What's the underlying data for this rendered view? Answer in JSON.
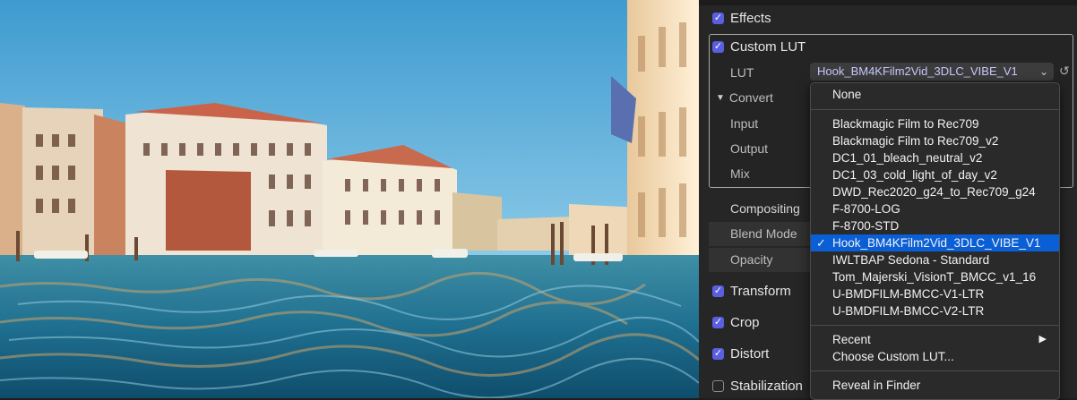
{
  "inspector": {
    "effects_label": "Effects",
    "custom_lut_label": "Custom LUT",
    "lut_label": "LUT",
    "lut_value": "Hook_BM4KFilm2Vid_3DLC_VIBE_V1",
    "convert_label": "Convert",
    "input_label": "Input",
    "output_label": "Output",
    "mix_label": "Mix",
    "compositing_label": "Compositing",
    "blend_mode_label": "Blend Mode",
    "opacity_label": "Opacity",
    "transform_label": "Transform",
    "crop_label": "Crop",
    "distort_label": "Distort",
    "stabilization_label": "Stabilization"
  },
  "lut_menu": {
    "none": "None",
    "items": [
      "Blackmagic Film to Rec709",
      "Blackmagic Film to Rec709_v2",
      "DC1_01_bleach_neutral_v2",
      "DC1_03_cold_light_of_day_v2",
      "DWD_Rec2020_g24_to_Rec709_g24",
      "F-8700-LOG",
      "F-8700-STD",
      "Hook_BM4KFilm2Vid_3DLC_VIBE_V1",
      "IWLTBAP Sedona - Standard",
      "Tom_Majerski_VisionT_BMCC_v1_16",
      "U-BMDFILM-BMCC-V1-LTR",
      "U-BMDFILM-BMCC-V2-LTR"
    ],
    "selected": "Hook_BM4KFilm2Vid_3DLC_VIBE_V1",
    "recent": "Recent",
    "choose_custom": "Choose Custom LUT...",
    "reveal": "Reveal in Finder"
  },
  "icons": {
    "checkmark": "checkmark-icon",
    "disclosure": "disclosure-triangle-icon",
    "chevron": "chevron-updown-icon",
    "reset": "reset-arrow-icon",
    "submenu": "submenu-arrow-icon"
  },
  "colors": {
    "accent": "#0a5fd6",
    "checkbox": "#5a5fe0",
    "panel": "#262626"
  }
}
